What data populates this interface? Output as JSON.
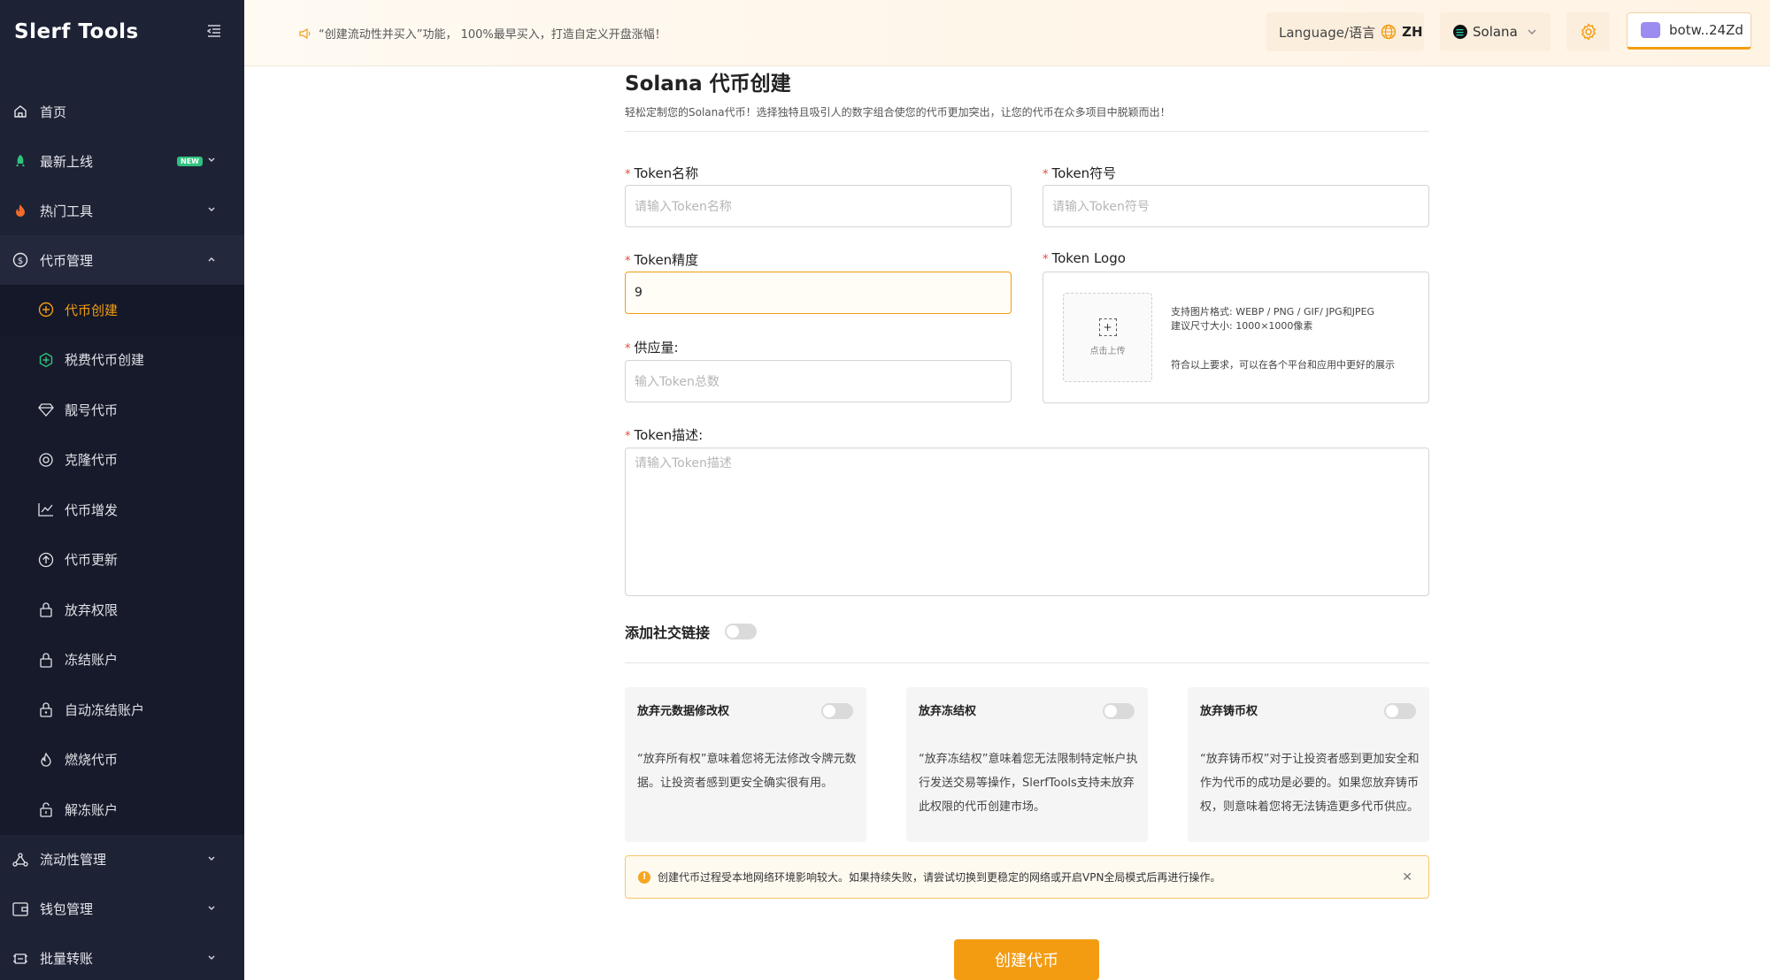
{
  "app": {
    "name": "Slerf Tools"
  },
  "header": {
    "notice": "“创建流动性并买入”功能， 100%最早买入，打造自定义开盘涨幅！",
    "language_label": "Language/语言",
    "language_value": "ZH",
    "chain": "Solana",
    "wallet": "botw..24Zd"
  },
  "sidebar": {
    "items": [
      {
        "label": "首页",
        "icon": "home-icon"
      },
      {
        "label": "最新上线",
        "icon": "rocket-icon",
        "badge": "NEW"
      },
      {
        "label": "热门工具",
        "icon": "fire-icon"
      },
      {
        "label": "代币管理",
        "icon": "dollar-circle-icon"
      }
    ],
    "token_sub": [
      {
        "label": "代币创建",
        "icon": "plus-circle-icon"
      },
      {
        "label": "税费代币创建",
        "icon": "tax-plus-icon"
      },
      {
        "label": "靓号代币",
        "icon": "diamond-icon"
      },
      {
        "label": "克隆代币",
        "icon": "clone-icon"
      },
      {
        "label": "代币增发",
        "icon": "chart-line-icon"
      },
      {
        "label": "代币更新",
        "icon": "arrow-up-circle-icon"
      },
      {
        "label": "放弃权限",
        "icon": "lock-icon"
      },
      {
        "label": "冻结账户",
        "icon": "lock-icon"
      },
      {
        "label": "自动冻结账户",
        "icon": "lock-icon"
      },
      {
        "label": "燃烧代币",
        "icon": "flame-icon"
      },
      {
        "label": "解冻账户",
        "icon": "unlock-icon"
      }
    ],
    "bottom": [
      {
        "label": "流动性管理",
        "icon": "network-icon"
      },
      {
        "label": "钱包管理",
        "icon": "wallet-icon"
      },
      {
        "label": "批量转账",
        "icon": "transfer-icon"
      }
    ]
  },
  "form": {
    "title": "Solana 代币创建",
    "subtitle": "轻松定制您的Solana代币！选择独特且吸引人的数字组合使您的代币更加突出，让您的代币在众多项目中脱颖而出！",
    "required_mark": "*",
    "name_label": "Token名称",
    "name_placeholder": "请输入Token名称",
    "symbol_label": "Token符号",
    "symbol_placeholder": "请输入Token符号",
    "decimals_label": "Token精度",
    "decimals_value": "9",
    "supply_label": "供应量:",
    "supply_placeholder": "输入Token总数",
    "logo_label": "Token Logo",
    "upload_text": "点击上传",
    "logo_formats": "支持图片格式:   WEBP / PNG / GIF/ JPG和JPEG",
    "logo_size": "建议尺寸大小:   1000×1000像素",
    "logo_hint": "符合以上要求，可以在各个平台和应用中更好的展示",
    "desc_label": "Token描述:",
    "desc_placeholder": "请输入Token描述",
    "social_label": "添加社交链接",
    "cards": [
      {
        "title": "放弃元数据修改权",
        "desc": "“放弃所有权”意味着您将无法修改令牌元数据。让投资者感到更安全确实很有用。"
      },
      {
        "title": "放弃冻结权",
        "desc": "“放弃冻结权”意味着您无法限制特定帐户执行发送交易等操作，SlerfTools支持未放弃此权限的代币创建市场。"
      },
      {
        "title": "放弃铸币权",
        "desc": "“放弃铸币权”对于让投资者感到更加安全和作为代币的成功是必要的。如果您放弃铸币权，则意味着您将无法铸造更多代币供应。"
      }
    ],
    "alert": "创建代币过程受本地网络环境影响较大。如果持续失败，请尝试切换到更稳定的网络或开启VPN全局模式后再进行操作。",
    "submit": "创建代币"
  },
  "colors": {
    "accent": "#f39c12",
    "sidebar": "#1e2235"
  }
}
